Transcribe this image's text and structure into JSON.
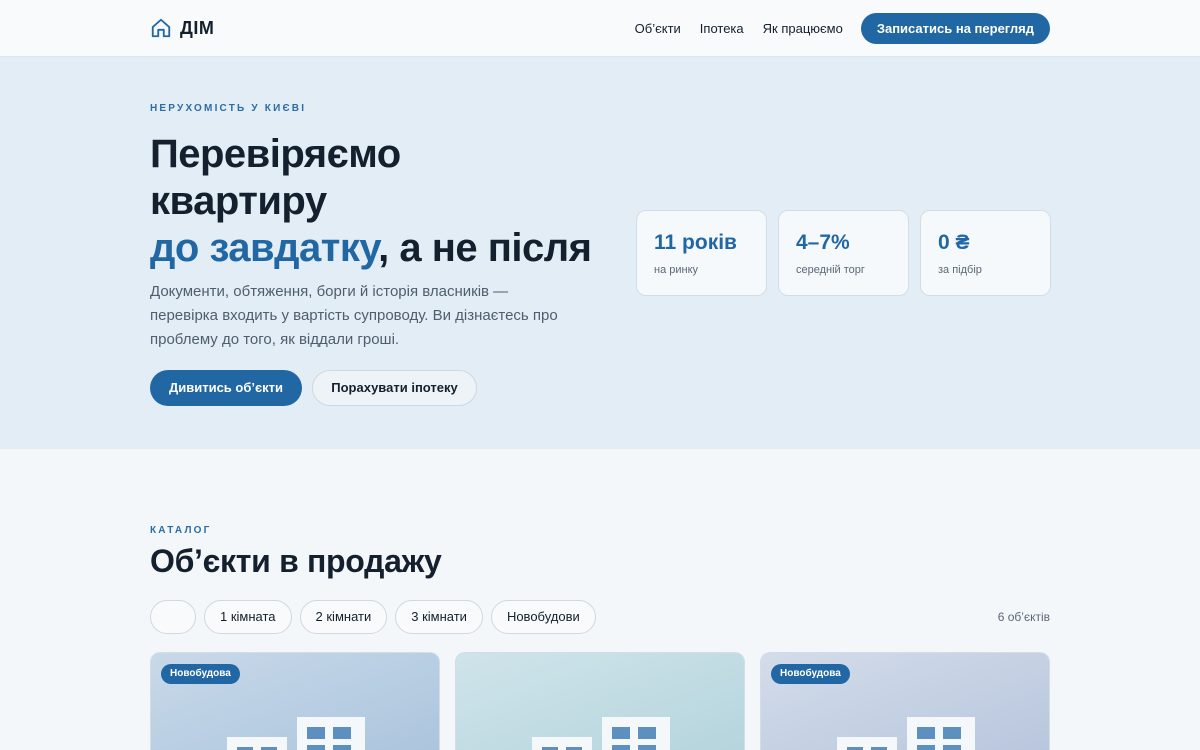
{
  "header": {
    "brand": "ДІМ",
    "nav": [
      "Об’єкти",
      "Іпотека",
      "Як працюємо"
    ],
    "cta": "Записатись на перегляд"
  },
  "hero": {
    "eyebrow": "НЕРУХОМІСТЬ У КИЄВІ",
    "title_line1": "Перевіряємо",
    "title_line2": "квартиру",
    "title_accent": "до завдатку",
    "title_rest": ", а не після",
    "description": "Документи, обтяження, борги й історія власників — перевірка входить у вартість супроводу. Ви дізнаєтесь про проблему до того, як віддали гроші.",
    "primary_button": "Дивитись об’єкти",
    "secondary_button": "Порахувати іпотеку",
    "stats": [
      {
        "value": "11 років",
        "label": "на ринку"
      },
      {
        "value": "4–7%",
        "label": "середній торг"
      },
      {
        "value": "0 ₴",
        "label": "за підбір"
      }
    ]
  },
  "catalog": {
    "eyebrow": "КАТАЛОГ",
    "title": "Об’єкти в продажу",
    "filters": [
      "",
      "1 кімната",
      "2 кімнати",
      "3 кімнати",
      "Новобудови"
    ],
    "count": "6 об’єктів",
    "cards": [
      {
        "badge": "Новобудова"
      },
      {
        "badge": ""
      },
      {
        "badge": "Новобудова"
      }
    ]
  },
  "colors": {
    "accent": "#2167a4",
    "hero_bg": "#e3edf5",
    "page_bg": "#f4f7fa"
  }
}
